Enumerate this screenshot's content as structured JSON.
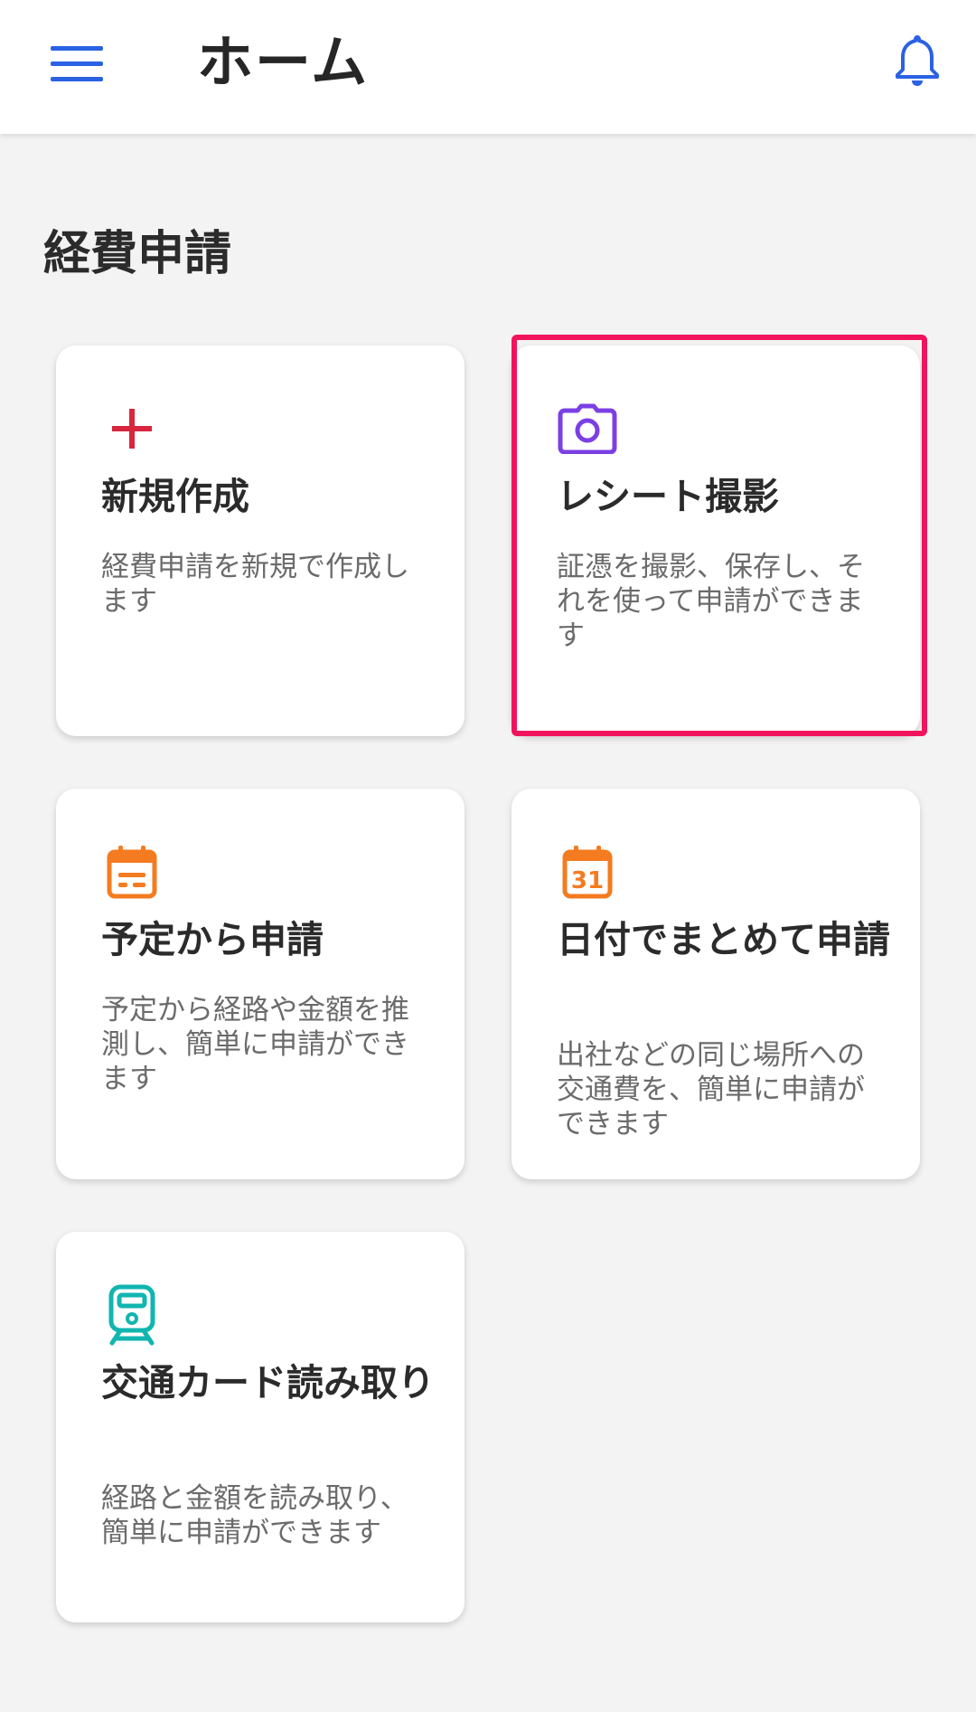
{
  "header": {
    "title": "ホーム"
  },
  "section": {
    "title": "経費申請"
  },
  "cards": [
    {
      "title": "新規作成",
      "description": "経費申請を新規で作成します",
      "icon": "plus-icon",
      "icon_color": "#d7263d"
    },
    {
      "title": "レシート撮影",
      "description": "証憑を撮影、保存し、それを使って申請ができます",
      "icon": "camera-icon",
      "icon_color": "#7b3fe4"
    },
    {
      "title": "予定から申請",
      "description": "予定から経路や金額を推測し、簡単に申請ができます",
      "icon": "calendar-icon",
      "icon_color": "#f47b20"
    },
    {
      "title": "日付でまとめて申請",
      "description": "出社などの同じ場所への交通費を、簡単に申請ができます",
      "icon": "calendar-31-icon",
      "icon_color": "#f47b20",
      "icon_text": "31"
    },
    {
      "title": "交通カード読み取り",
      "description": "経路と金額を読み取り、簡単に申請ができます",
      "icon": "train-icon",
      "icon_color": "#12b5b0"
    }
  ],
  "colors": {
    "accent": "#2b62e3",
    "highlight": "#f1145d",
    "background": "#f4f3f3"
  }
}
